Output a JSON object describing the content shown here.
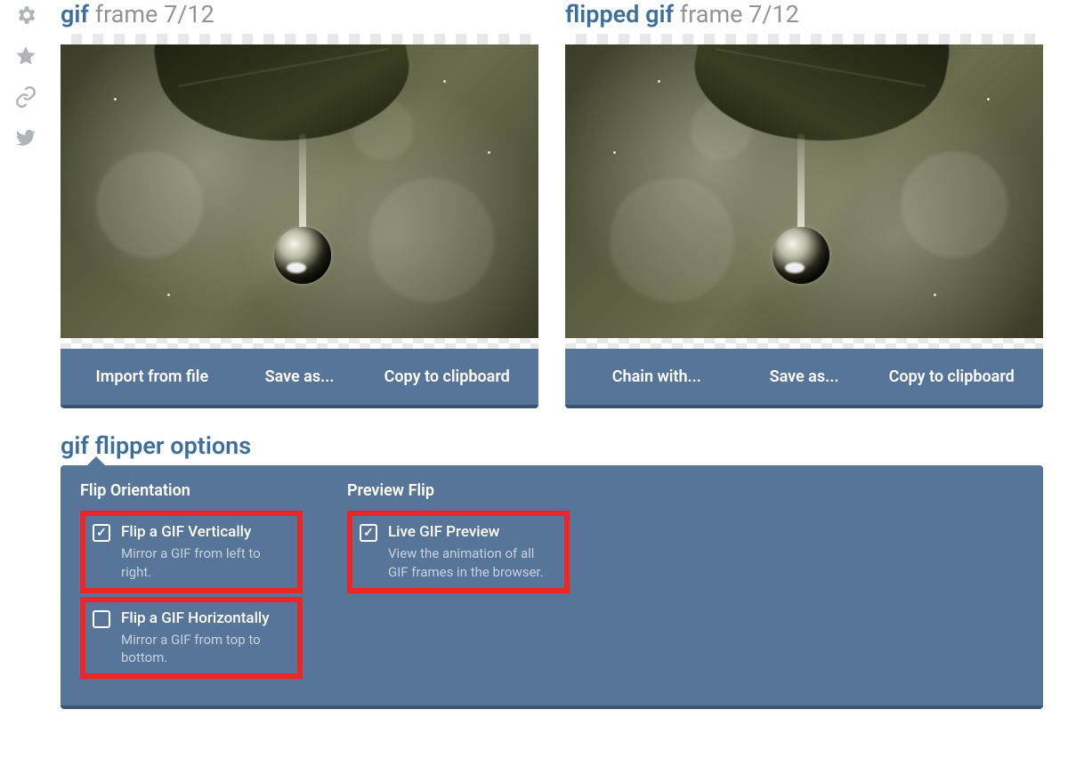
{
  "sidebar": {
    "icons": [
      "gear",
      "star",
      "link",
      "twitter"
    ]
  },
  "panels": {
    "left": {
      "title_blue": "gif",
      "title_gray": "frame 7/12",
      "actions": [
        "Import from file",
        "Save as...",
        "Copy to clipboard"
      ]
    },
    "right": {
      "title_blue": "flipped gif",
      "title_gray": "frame 7/12",
      "actions": [
        "Chain with...",
        "Save as...",
        "Copy to clipboard"
      ]
    }
  },
  "options": {
    "title": "gif flipper options",
    "columns": [
      {
        "heading": "Flip Orientation",
        "items": [
          {
            "label": "Flip a GIF Vertically",
            "desc": "Mirror a GIF from left to right.",
            "checked": true,
            "highlighted": true
          },
          {
            "label": "Flip a GIF Horizontally",
            "desc": "Mirror a GIF from top to bottom.",
            "checked": false,
            "highlighted": true
          }
        ]
      },
      {
        "heading": "Preview Flip",
        "items": [
          {
            "label": "Live GIF Preview",
            "desc": "View the animation of all GIF frames in the browser.",
            "checked": true,
            "highlighted": true
          }
        ]
      }
    ]
  }
}
